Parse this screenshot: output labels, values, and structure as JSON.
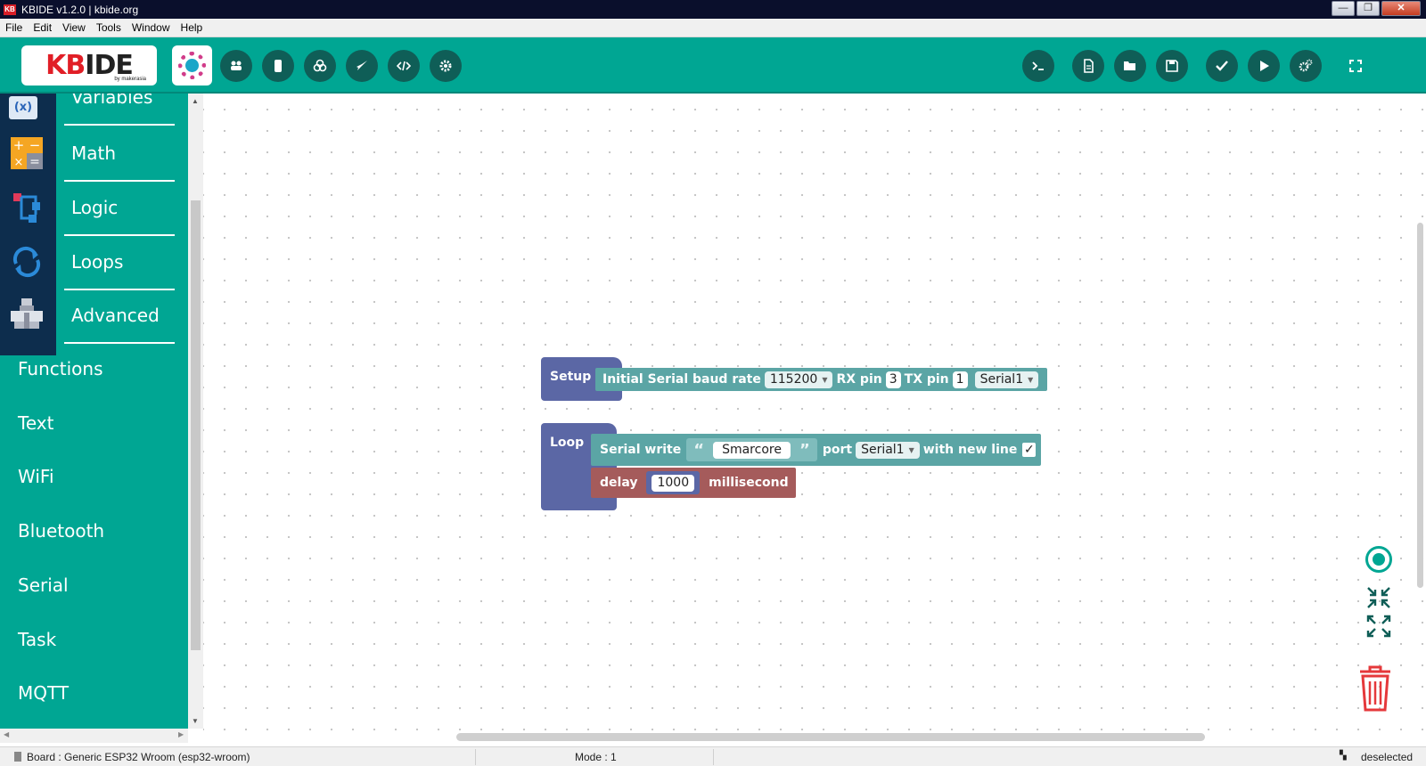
{
  "window": {
    "title": "KBIDE v1.2.0 | kbide.org",
    "logo_text": "KB",
    "minimize": "—",
    "maximize": "❐",
    "close": "✕"
  },
  "menubar": [
    "File",
    "Edit",
    "View",
    "Tools",
    "Window",
    "Help"
  ],
  "toolbar": {
    "logo_text_kb": "KB",
    "logo_text_ide": "IDE",
    "logo_by": "by makerasia",
    "left_buttons": [
      "board-icon",
      "plugin-icon",
      "cloud-icon",
      "rocket-icon",
      "code-icon",
      "settings-icon"
    ],
    "right_buttons": [
      "terminal-icon",
      "new-file-icon",
      "open-folder-icon",
      "save-icon",
      "check-icon",
      "play-icon",
      "gears-icon",
      "fullscreen-icon"
    ]
  },
  "sidebar": {
    "categories": [
      {
        "label": "Variables",
        "icon": "variables-icon",
        "icon_text": "(x)"
      },
      {
        "label": "Math",
        "icon": "math-icon"
      },
      {
        "label": "Logic",
        "icon": "logic-icon"
      },
      {
        "label": "Loops",
        "icon": "loops-icon"
      },
      {
        "label": "Advanced",
        "icon": "advanced-icon"
      }
    ],
    "plugins": [
      "Functions",
      "Text",
      "WiFi",
      "Bluetooth",
      "Serial",
      "Task",
      "MQTT"
    ]
  },
  "blocks": {
    "setup": {
      "label": "Setup",
      "serial_init": {
        "prefix": "Initial Serial baud rate",
        "baud": "115200",
        "rx_label": "RX pin",
        "rx_value": "3",
        "tx_label": "TX pin",
        "tx_value": "1",
        "port": "Serial1"
      }
    },
    "loop": {
      "label": "Loop",
      "serial_write": {
        "prefix": "Serial write",
        "open_quote": "“",
        "text": "Smarcore",
        "close_quote": "”",
        "port_label": "port",
        "port": "Serial1",
        "newline_label": "with new line",
        "newline_checked": "✓"
      },
      "delay": {
        "prefix": "delay",
        "value": "1000",
        "unit": "millisecond"
      }
    },
    "colors": {
      "hat": "#5b67a5",
      "serial": "#5ba5a5",
      "delay": "#a55b5b",
      "accent": "#00a693"
    }
  },
  "statusbar": {
    "board": "Board : Generic ESP32 Wroom (esp32-wroom)",
    "mode": "Mode : 1",
    "selection": "deselected"
  }
}
